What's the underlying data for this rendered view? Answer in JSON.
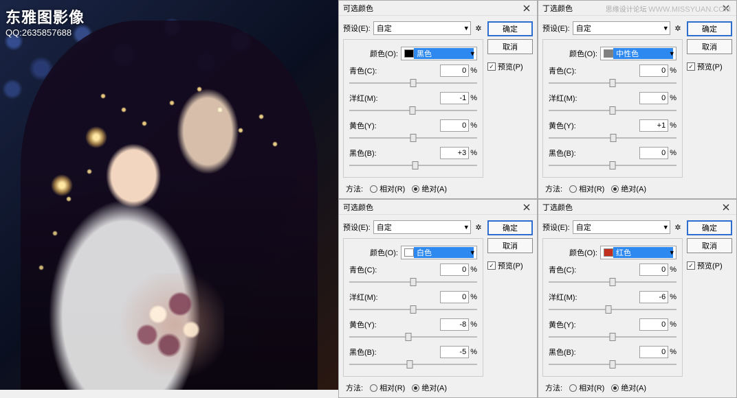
{
  "watermark": {
    "title": "东雅图影像",
    "qq": "QQ:2635857688"
  },
  "forum": {
    "cn": "思缘设计论坛",
    "url": "WWW.MISSYUAN.COM"
  },
  "common": {
    "dialogTitle": "可选颜色",
    "dialogTitleAlt": "丁选颜色",
    "presetLabel": "预设(E):",
    "presetValue": "自定",
    "colorLabel": "颜色(O):",
    "ok": "确定",
    "cancel": "取消",
    "previewLabel": "预览(P)",
    "methodLabel": "方法:",
    "relative": "相对(R)",
    "absolute": "绝对(A)",
    "pct": "%",
    "cyan": "青色(C):",
    "magenta": "洋红(M):",
    "yellow": "黄色(Y):",
    "black": "黑色(B):"
  },
  "panels": {
    "topLeft": {
      "colorName": "黑色",
      "colorNameHighlighted": true,
      "swatch": "#000000",
      "cyan": "0",
      "magenta": "-1",
      "yellow": "0",
      "black": "+3"
    },
    "topRight": {
      "colorName": "中性色",
      "colorNameHighlighted": true,
      "swatch": "#808080",
      "cyan": "0",
      "magenta": "0",
      "yellow": "+1",
      "black": "0"
    },
    "bottomLeft": {
      "colorName": "白色",
      "colorNameHighlighted": true,
      "swatch": "#ffffff",
      "cyan": "0",
      "magenta": "0",
      "yellow": "-8",
      "black": "-5"
    },
    "bottomRight": {
      "colorName": "红色",
      "colorNameHighlighted": true,
      "swatch": "#c23020",
      "cyan": "0",
      "magenta": "-6",
      "yellow": "0",
      "black": "0"
    }
  }
}
